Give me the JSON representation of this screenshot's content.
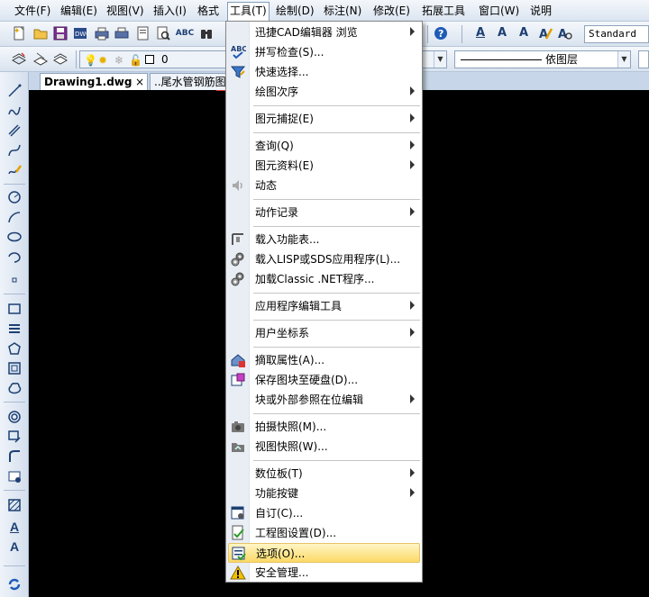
{
  "menubar": {
    "items": [
      {
        "label": "文件(F)"
      },
      {
        "label": "编辑(E)"
      },
      {
        "label": "视图(V)"
      },
      {
        "label": "插入(I)"
      },
      {
        "label": "格式"
      },
      {
        "label": "工具(T)"
      },
      {
        "label": "绘制(D)"
      },
      {
        "label": "标注(N)"
      },
      {
        "label": "修改(E)"
      },
      {
        "label": "拓展工具"
      },
      {
        "label": "窗口(W)"
      },
      {
        "label": "说明"
      }
    ]
  },
  "toolbar": {
    "text_style": "Standard",
    "layer_value": "0",
    "linetype_value": "依图层"
  },
  "tabs": [
    {
      "label": "Drawing1.dwg",
      "close": "×"
    },
    {
      "label": "..尾水管钢筋图.d"
    }
  ],
  "menu": {
    "items": [
      {
        "label": "迅捷CAD编辑器 浏览"
      },
      {
        "label": "拼写检查(S)..."
      },
      {
        "label": "快速选择..."
      },
      {
        "label": "绘图次序"
      },
      {
        "label": "图元捕捉(E)"
      },
      {
        "label": "查询(Q)"
      },
      {
        "label": "图元资料(E)"
      },
      {
        "label": "动态"
      },
      {
        "label": "动作记录"
      },
      {
        "label": "载入功能表..."
      },
      {
        "label": "载入LISP或SDS应用程序(L)..."
      },
      {
        "label": "加载Classic .NET程序..."
      },
      {
        "label": "应用程序编辑工具"
      },
      {
        "label": "用户坐标系"
      },
      {
        "label": "摘取属性(A)..."
      },
      {
        "label": "保存图块至硬盘(D)..."
      },
      {
        "label": "块或外部参照在位编辑"
      },
      {
        "label": "拍摄快照(M)..."
      },
      {
        "label": "视图快照(W)..."
      },
      {
        "label": "数位板(T)"
      },
      {
        "label": "功能按键"
      },
      {
        "label": "自订(C)..."
      },
      {
        "label": "工程图设置(D)..."
      },
      {
        "label": "选项(O)..."
      },
      {
        "label": "安全管理..."
      }
    ]
  },
  "icons": {
    "spell": "ABC",
    "text_a": "A"
  },
  "colors": {
    "highlight": "#fbd966",
    "canvas": "#000000",
    "menubar": "#dbe5f1"
  }
}
